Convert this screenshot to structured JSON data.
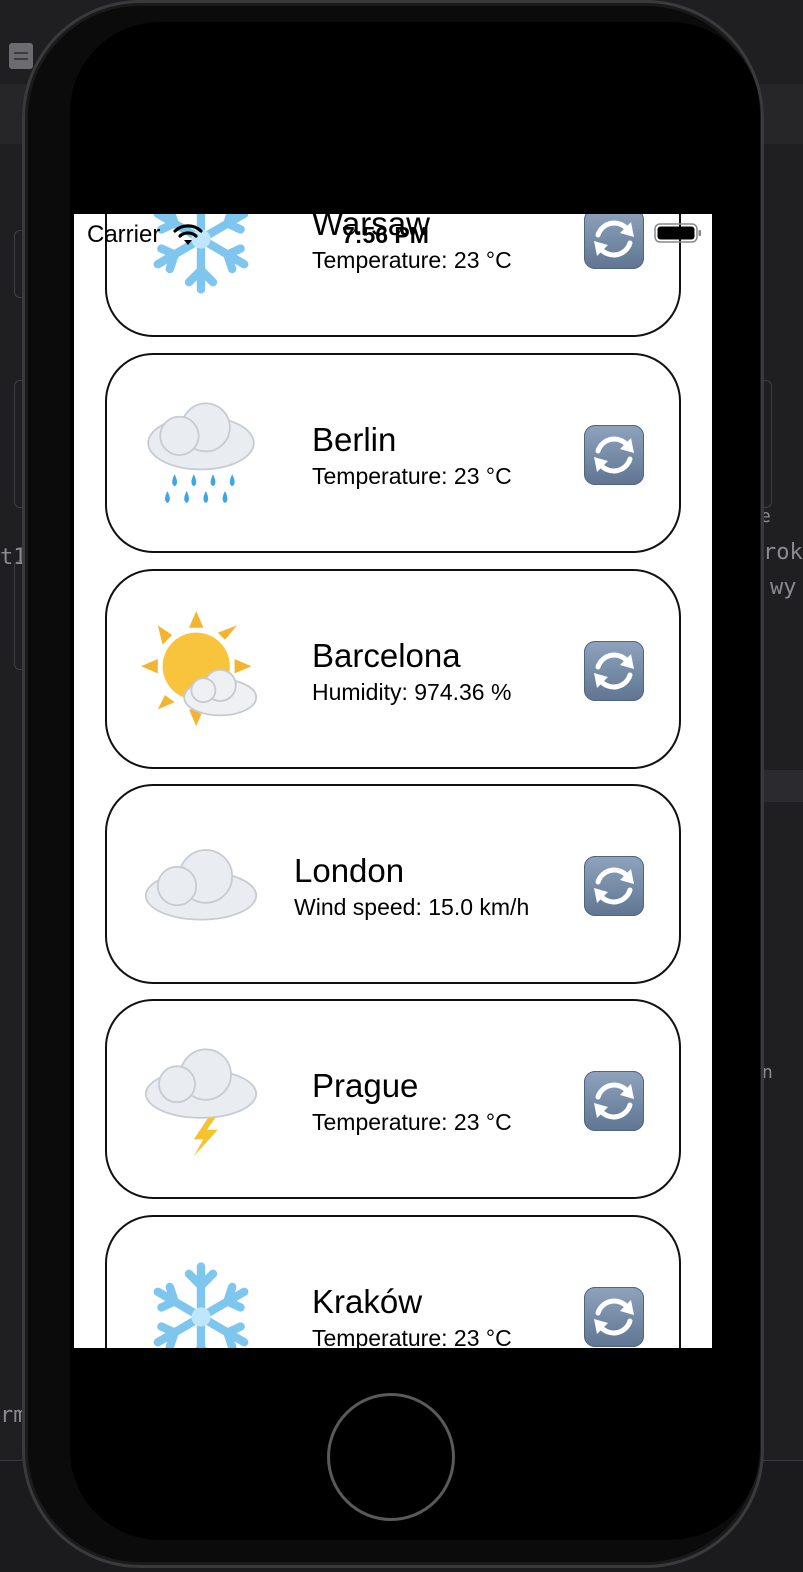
{
  "status_bar": {
    "carrier": "Carrier",
    "time": "7:56 PM"
  },
  "ide": {
    "line1": "e",
    "line2": "rok",
    "line3": "wy",
    "line4": "n",
    "left1": "t1",
    "left2": "rm"
  },
  "cities": [
    {
      "name": "Warsaw",
      "detail": "Temperature: 23 °C",
      "icon": "snowflake-icon"
    },
    {
      "name": "Berlin",
      "detail": "Temperature: 23 °C",
      "icon": "rain-cloud-icon"
    },
    {
      "name": "Barcelona",
      "detail": "Humidity: 974.36 %",
      "icon": "sun-behind-cloud-icon"
    },
    {
      "name": "London",
      "detail": "Wind speed: 15.0 km/h",
      "icon": "cloud-icon"
    },
    {
      "name": "Prague",
      "detail": "Temperature: 23 °C",
      "icon": "thunder-cloud-icon"
    },
    {
      "name": "Kraków",
      "detail": "Temperature: 23 °C",
      "icon": "snowflake-icon"
    }
  ]
}
